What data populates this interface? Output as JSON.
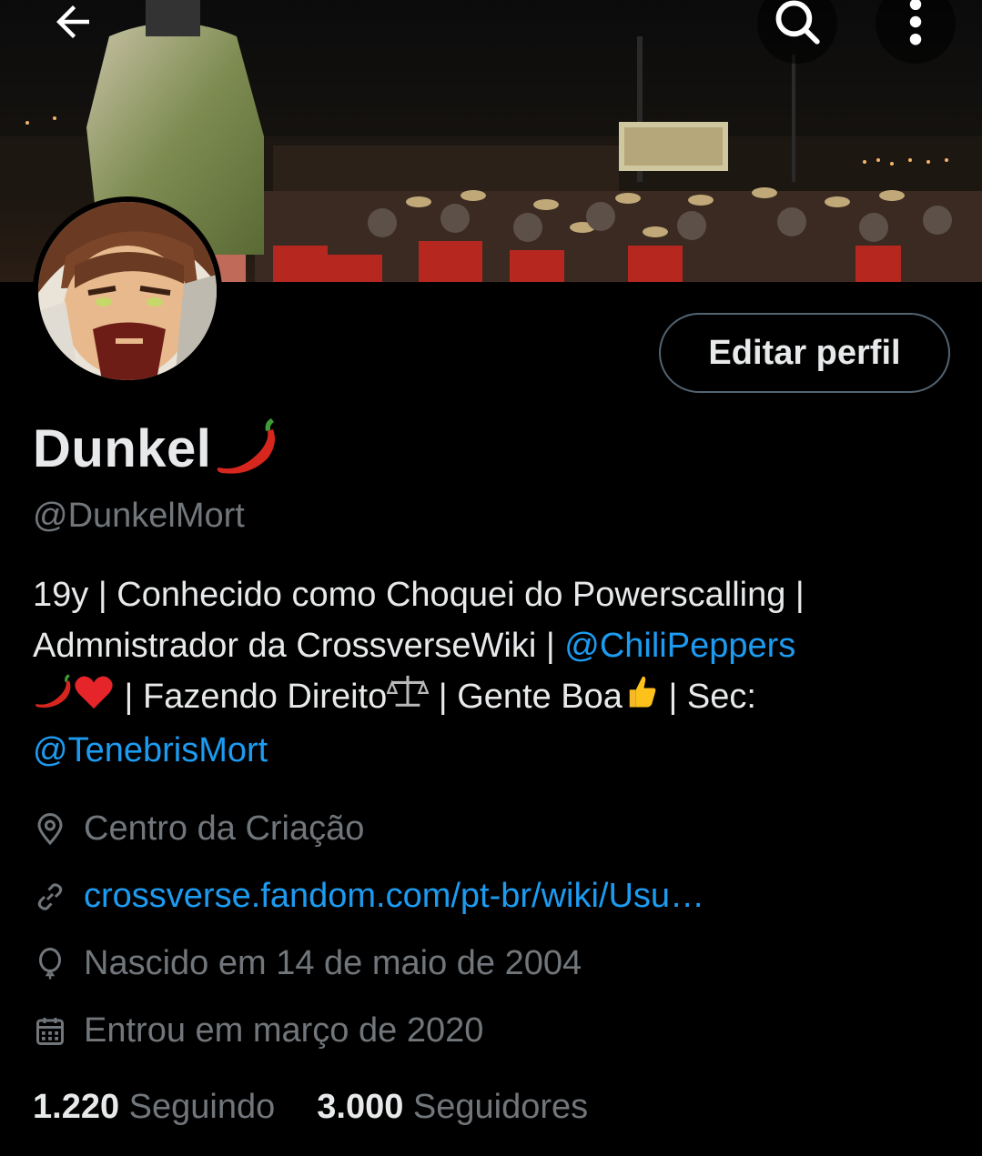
{
  "header": {
    "back_icon": "arrow-left-icon",
    "search_icon": "search-icon",
    "more_icon": "more-vertical-icon"
  },
  "profile": {
    "name": "Dunkel",
    "name_emoji": "chili-pepper",
    "handle": "@DunkelMort",
    "edit_button_label": "Editar perfil"
  },
  "bio": {
    "line1": "19y | Conhecido como Choquei do Powerscalling |",
    "line2_text": "Admnistrador da CrossverseWiki | ",
    "line2_link": "@ChiliPeppers",
    "line3_a": " | Fazendo Direito",
    "line3_b": " | Gente Boa",
    "line3_c": " | Sec:",
    "line4_link": "@TenebrisMort"
  },
  "meta": {
    "location": "Centro da Criação",
    "website": "crossverse.fandom.com/pt-br/wiki/Usu…",
    "birthday": "Nascido em 14 de maio de 2004",
    "joined": "Entrou em março de 2020"
  },
  "stats": {
    "following_count": "1.220",
    "following_label": "Seguindo",
    "followers_count": "3.000",
    "followers_label": "Seguidores"
  },
  "colors": {
    "background": "#000000",
    "text": "#e7e9ea",
    "secondary": "#71767b",
    "link": "#1d9bf0",
    "border": "#536471"
  }
}
